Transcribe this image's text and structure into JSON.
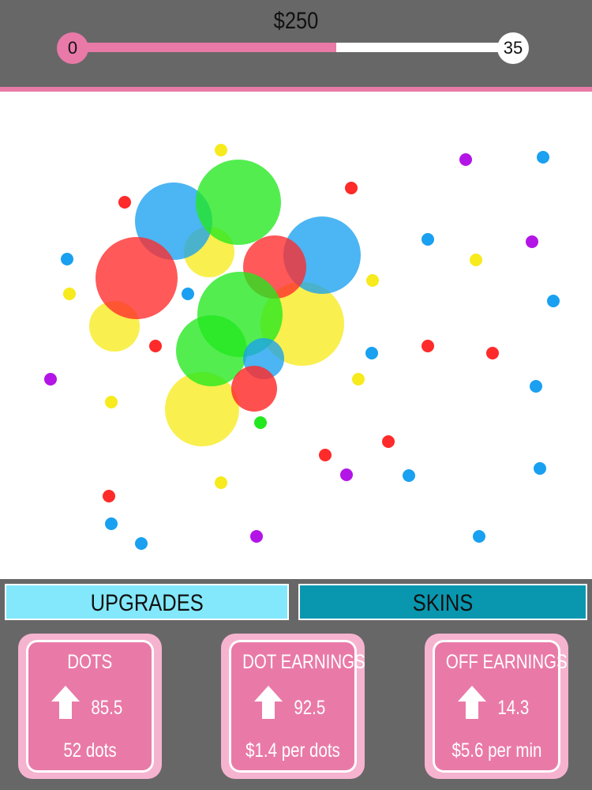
{
  "header": {
    "money": "$250",
    "level_start": "0",
    "level_end": "35",
    "progress": 0.6
  },
  "colors": {
    "accent_pink": "#e97aa8",
    "background_gray": "#676767",
    "tab_upgrades": "#83e8fb",
    "tab_skins": "#0997b0",
    "dot_red": "#ff2a2a",
    "dot_blue": "#1aa0f0",
    "dot_yellow": "#f7ea1d",
    "dot_green": "#22e81f",
    "dot_purple": "#b315e6"
  },
  "tabs": {
    "upgrades_label": "UPGRADES",
    "skins_label": "SKINS"
  },
  "cards": [
    {
      "title": "DOTS",
      "icon": "arrow-up-icon",
      "value": "85.5",
      "subtitle": "52 dots"
    },
    {
      "title": "DOT EARNINGS",
      "icon": "arrow-up-icon",
      "value": "92.5",
      "subtitle": "$1.4 per dots"
    },
    {
      "title": "OFF EARNINGS",
      "icon": "arrow-up-icon",
      "value": "14.3",
      "subtitle": "$5.6 per min"
    }
  ]
}
